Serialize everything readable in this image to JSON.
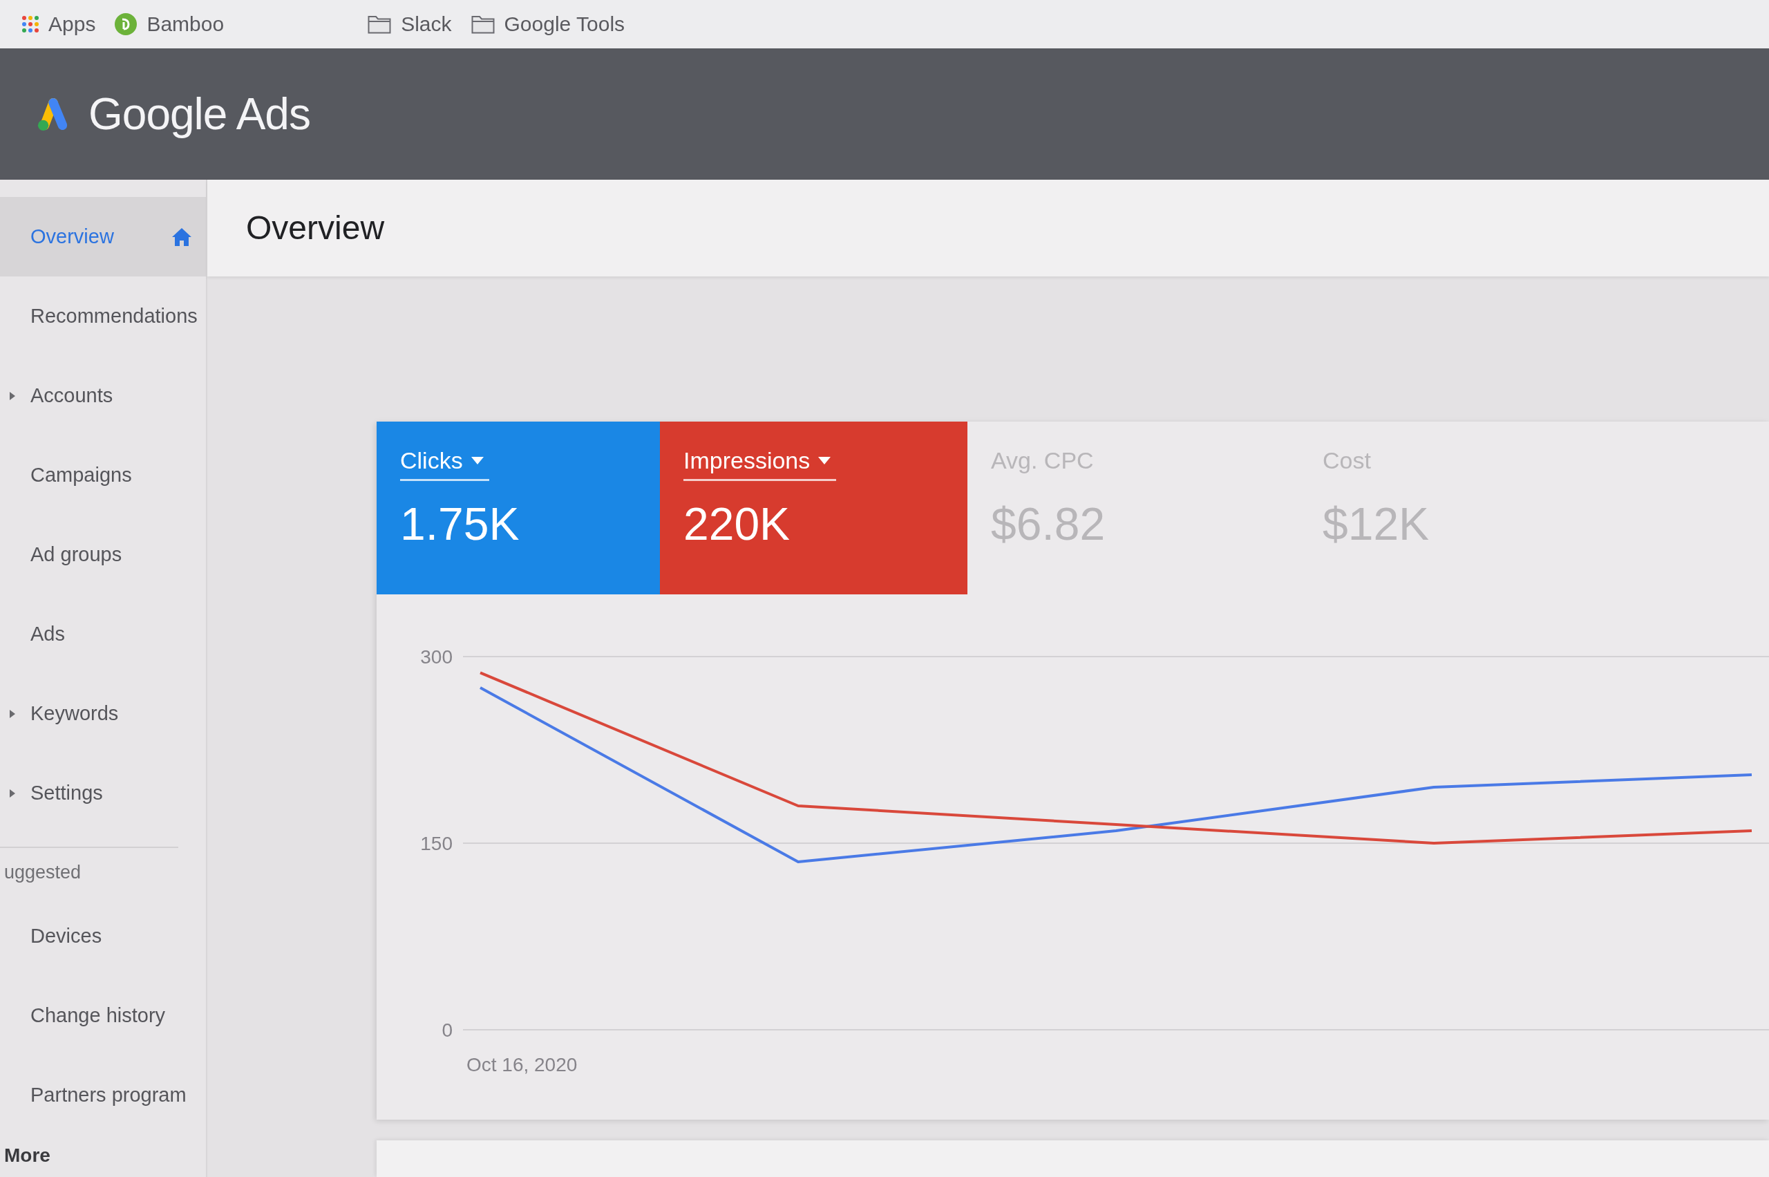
{
  "bookmarks_bar": {
    "items": [
      {
        "kind": "apps",
        "label": "Apps"
      },
      {
        "kind": "site",
        "label": "Bamboo"
      },
      {
        "kind": "folder",
        "label": "Slack"
      },
      {
        "kind": "folder",
        "label": "Google Tools"
      }
    ]
  },
  "header": {
    "product": "Google Ads"
  },
  "sidebar": {
    "items": [
      {
        "label": "Overview",
        "kind": "home",
        "selected": true
      },
      {
        "label": "Recommendations",
        "kind": "link",
        "selected": false
      },
      {
        "label": "Accounts",
        "kind": "group",
        "selected": false
      },
      {
        "label": "Campaigns",
        "kind": "link",
        "selected": false
      },
      {
        "label": "Ad groups",
        "kind": "link",
        "selected": false
      },
      {
        "label": "Ads",
        "kind": "link",
        "selected": false
      },
      {
        "label": "Keywords",
        "kind": "group",
        "selected": false
      },
      {
        "label": "Settings",
        "kind": "group",
        "selected": false
      }
    ],
    "section": {
      "title": "uggested",
      "items": [
        {
          "label": "Devices",
          "selected": false
        },
        {
          "label": "Change history",
          "selected": false
        },
        {
          "label": "Partners program",
          "selected": false
        }
      ]
    },
    "more": "More"
  },
  "page": {
    "title": "Overview"
  },
  "chart_card": {
    "metrics": [
      {
        "label": "Clicks",
        "value": "1.75K",
        "selected": true,
        "color": "#1a87e5"
      },
      {
        "label": "Impressions",
        "value": "220K",
        "selected": true,
        "color": "#d73b2e"
      },
      {
        "label": "Avg. CPC",
        "value": "$6.82",
        "selected": false
      },
      {
        "label": "Cost",
        "value": "$12K",
        "selected": false
      }
    ],
    "start_date": "Oct 16, 2020",
    "chart_data": {
      "type": "line",
      "yticks": [
        {
          "value": 0,
          "label": "0"
        },
        {
          "value": 150,
          "label": "150"
        },
        {
          "value": 300,
          "label": "300"
        }
      ],
      "ylim": [
        0,
        300
      ],
      "series": [
        {
          "color": "#4a7ae6",
          "values": [
            275,
            135,
            160,
            195,
            205
          ]
        },
        {
          "color": "#d9483b",
          "values": [
            287,
            180,
            165,
            150,
            160
          ]
        }
      ]
    }
  }
}
